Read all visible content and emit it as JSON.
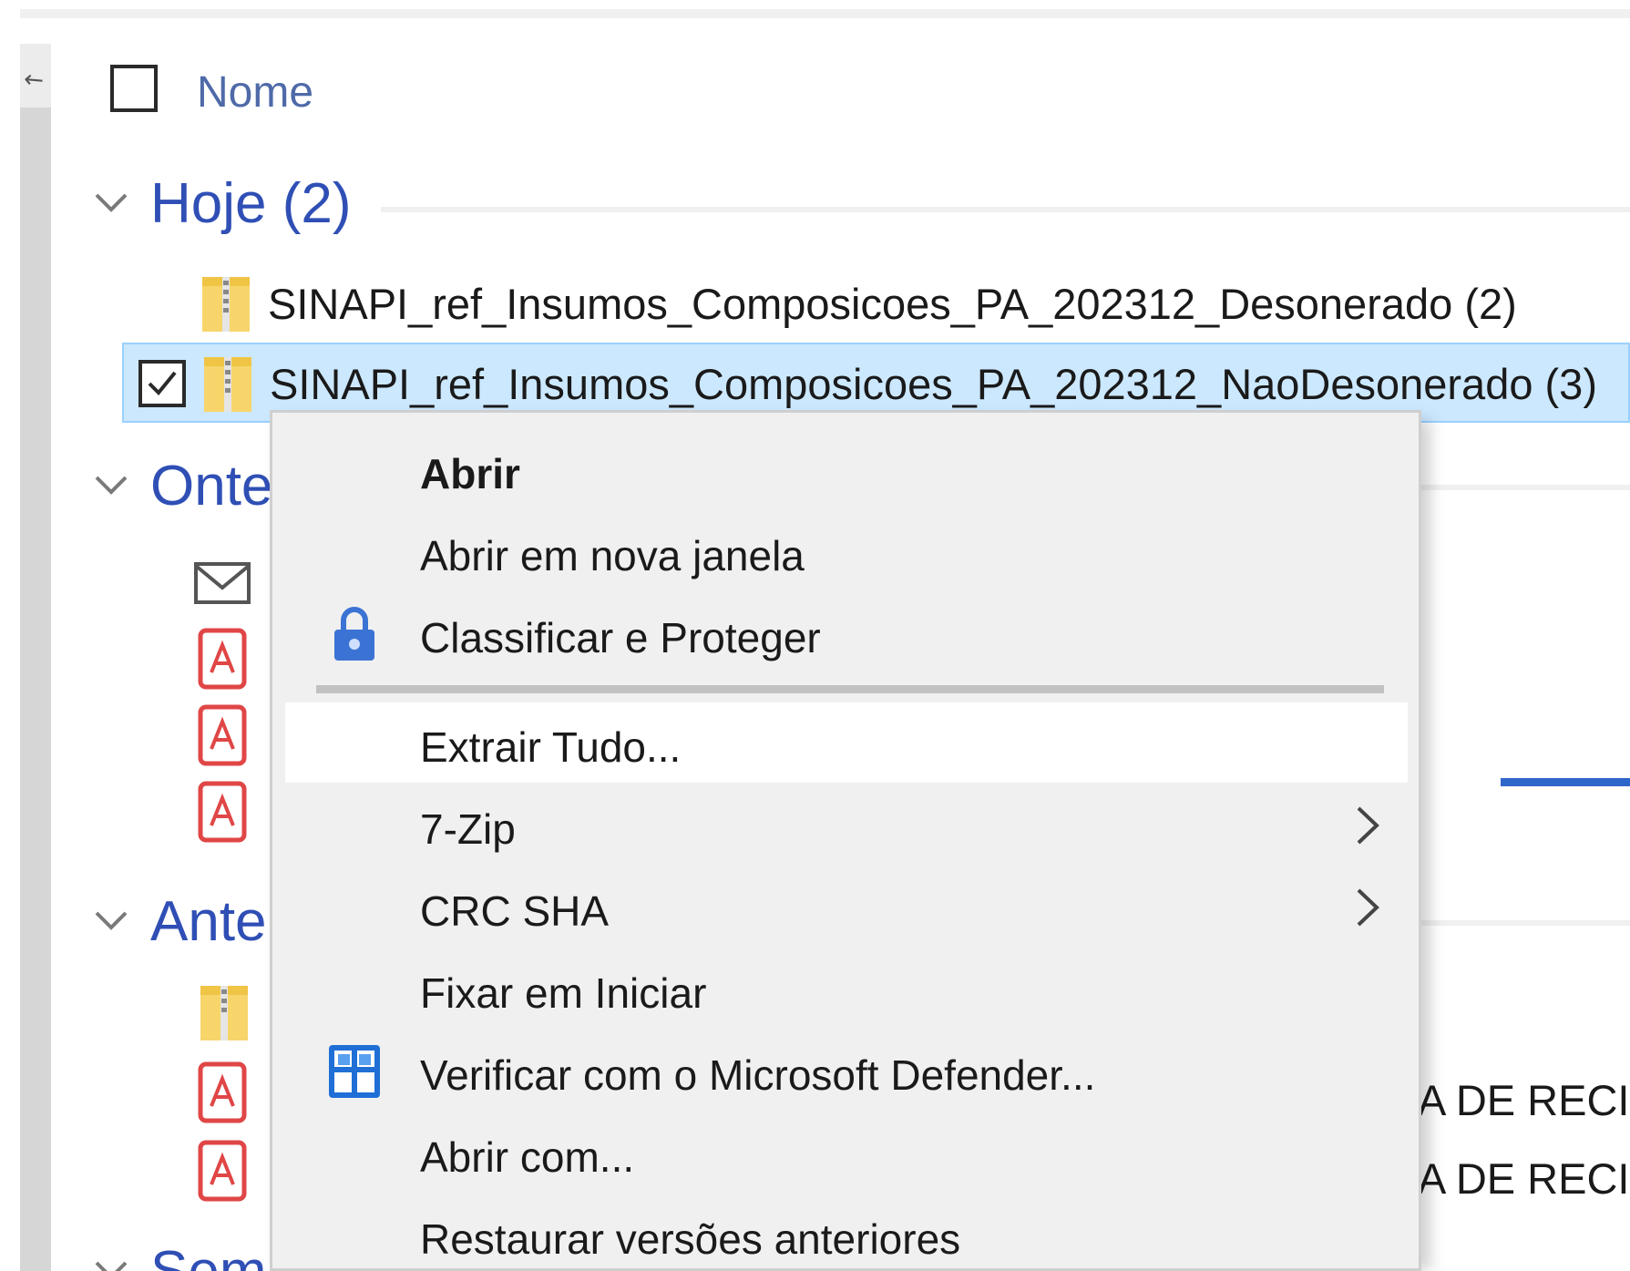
{
  "header": {
    "name_column": "Nome"
  },
  "groups": {
    "today": {
      "title": "Hoje (2)"
    },
    "yesterday": {
      "title": "Onte"
    },
    "earlier": {
      "title": "Ante"
    },
    "last": {
      "title": "Sem"
    }
  },
  "files": {
    "today": [
      {
        "name": "SINAPI_ref_Insumos_Composicoes_PA_202312_Desonerado (2)",
        "icon": "zip-folder-icon",
        "selected": false
      },
      {
        "name": "SINAPI_ref_Insumos_Composicoes_PA_202312_NaoDesonerado (3)",
        "icon": "zip-folder-icon",
        "selected": true
      }
    ],
    "partial_right_text": [
      "A DE RECI",
      "A DE RECI"
    ]
  },
  "context_menu": {
    "items": [
      {
        "label": "Abrir",
        "bold": true
      },
      {
        "label": "Abrir em nova janela"
      },
      {
        "label": "Classificar e Proteger",
        "icon": "classify-protect-icon"
      },
      {
        "label": "Extrair Tudo...",
        "hovered": true
      },
      {
        "label": "7-Zip",
        "submenu": true
      },
      {
        "label": "CRC SHA",
        "submenu": true
      },
      {
        "label": "Fixar em Iniciar"
      },
      {
        "label": "Verificar com o Microsoft Defender...",
        "icon": "defender-icon"
      },
      {
        "label": "Abrir com..."
      },
      {
        "label": "Restaurar versões anteriores"
      }
    ]
  },
  "colors": {
    "group_title": "#2f4fb5",
    "selection_bg": "#cce8ff",
    "menu_bg": "#f0f0f0",
    "accent_bar": "#2f66c9"
  }
}
